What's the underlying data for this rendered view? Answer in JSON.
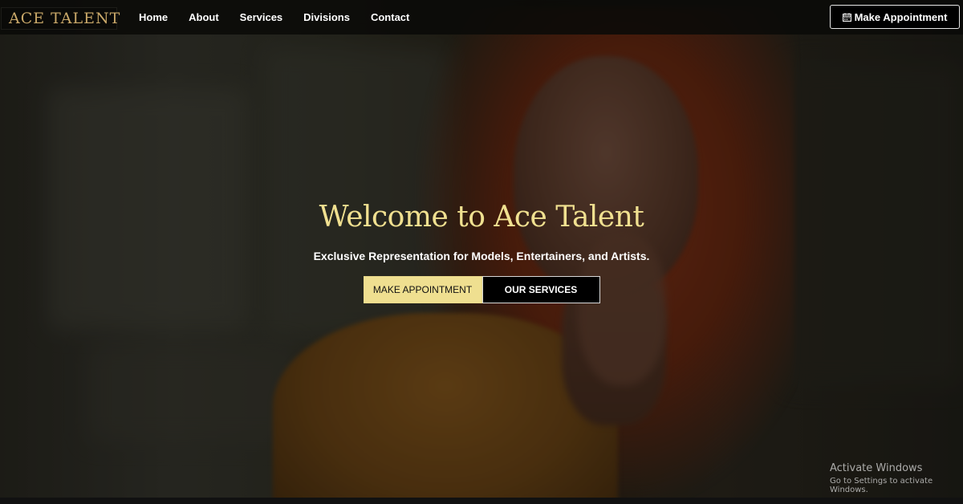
{
  "brand": {
    "name": "ACE TALENT",
    "accent_color": "#c9a869",
    "icon": "star-logo-icon"
  },
  "nav": {
    "items": [
      {
        "label": "Home"
      },
      {
        "label": "About"
      },
      {
        "label": "Services"
      },
      {
        "label": "Divisions"
      },
      {
        "label": "Contact"
      }
    ],
    "cta": {
      "label": "Make Appointment",
      "icon": "calendar-icon"
    }
  },
  "hero": {
    "title": "Welcome to Ace Talent",
    "title_color": "#f0e090",
    "subtitle": "Exclusive Representation for Models, Entertainers, and Artists.",
    "primary_button": "MAKE APPOINTMENT",
    "secondary_button": "OUR SERVICES",
    "primary_color": "#efdf90"
  },
  "watermark": {
    "title": "Activate Windows",
    "subtitle": "Go to Settings to activate Windows."
  }
}
